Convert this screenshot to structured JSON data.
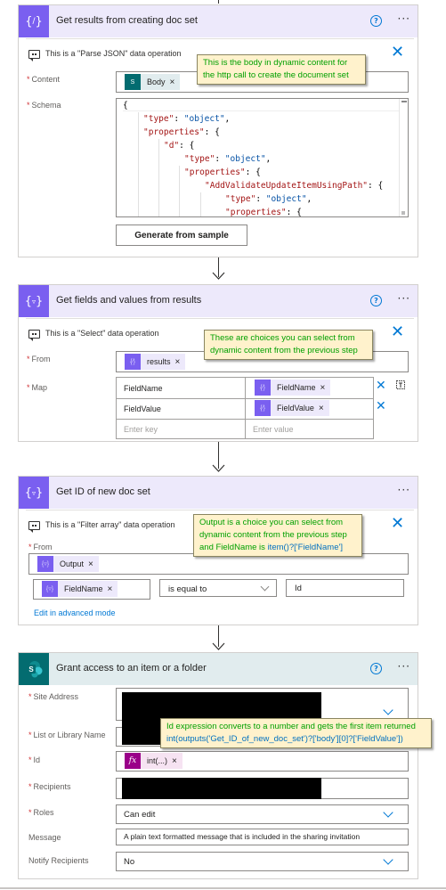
{
  "cards": {
    "parse_json": {
      "title": "Get results from creating doc set",
      "icon": "data-operation-icon",
      "comment": "This is a \"Parse JSON\" data operation",
      "content_label": "Content",
      "content_token": "Body",
      "schema_label": "Schema",
      "schema_lines": [
        "{",
        "\"type\": \"object\",",
        "\"properties\": {",
        "\"d\": {",
        "\"type\": \"object\",",
        "\"properties\": {",
        "\"AddValidateUpdateItemUsingPath\": {",
        "\"type\": \"object\",",
        "\"properties\": {"
      ],
      "generate_button": "Generate from sample",
      "callout": "This is the body in dynamic content for the http call to create the document set"
    },
    "select": {
      "title": "Get fields and values from results",
      "comment": "This is a \"Select\" data operation",
      "from_label": "From",
      "from_token": "results",
      "map_label": "Map",
      "map_rows": [
        {
          "key": "FieldName",
          "value_token": "FieldName"
        },
        {
          "key": "FieldValue",
          "value_token": "FieldValue"
        }
      ],
      "key_placeholder": "Enter key",
      "value_placeholder": "Enter value",
      "callout": "These are choices you can select from dynamic content from the previous step"
    },
    "filter": {
      "title": "Get ID of new doc set",
      "comment": "This is a \"Filter array\" data operation",
      "from_label": "From",
      "from_token": "Output",
      "condition_left_token": "FieldName",
      "condition_operator": "is equal to",
      "condition_right": "Id",
      "advanced_link": "Edit in advanced mode",
      "callout_line1": "Output is a choice  you can select from",
      "callout_line2": "dynamic content from the previous step",
      "callout_line3_prefix": "and FieldName is ",
      "callout_line3_expr": "item()?['FieldName']"
    },
    "grant": {
      "title": "Grant access to an item or a folder",
      "site_label": "Site Address",
      "list_label": "List or Library Name",
      "id_label": "Id",
      "id_token": "int(...)",
      "recipients_label": "Recipients",
      "roles_label": "Roles",
      "roles_value": "Can edit",
      "message_label": "Message",
      "message_placeholder": "A plain text formatted message that is included in the sharing invitation",
      "notify_label": "Notify Recipients",
      "notify_value": "No",
      "callout_line1": "Id expression converts to a number and gets the first item returned",
      "callout_line2": "int(outputs('Get_ID_of_new_doc_set')?['body'][0]?['FieldValue'])"
    }
  },
  "common": {
    "required_mark": "*",
    "more": "···",
    "help": "?",
    "token_remove": "×",
    "close": "✕"
  },
  "colors": {
    "data_op_accent": "#7a5ff0",
    "sharepoint_accent": "#036c70",
    "link_blue": "#0078d4",
    "callout_bg": "#fff2cc",
    "callout_text": "#00a000"
  }
}
